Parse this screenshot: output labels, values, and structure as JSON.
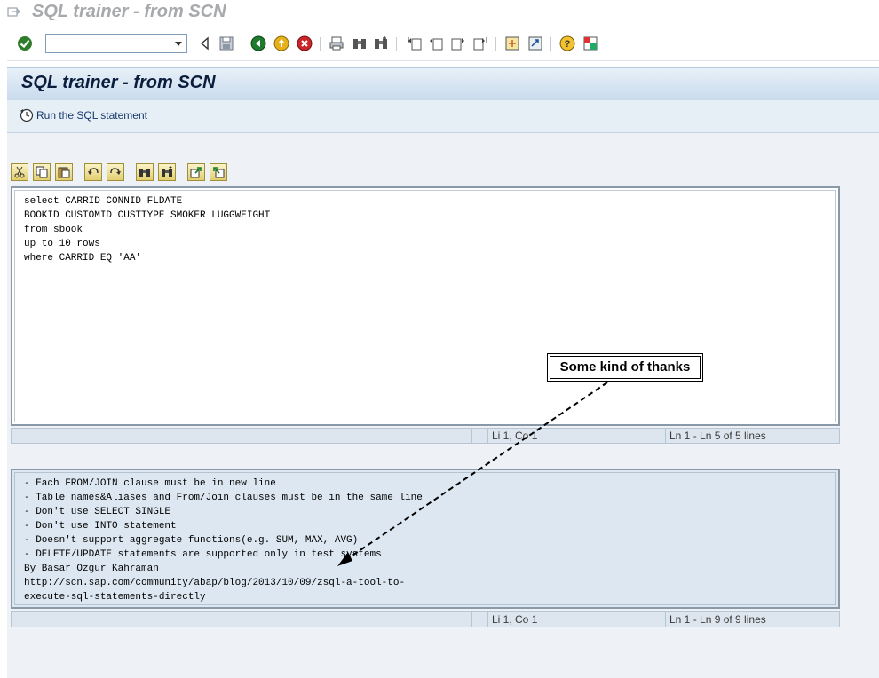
{
  "window": {
    "title": "SQL trainer - from SCN"
  },
  "toolbar": {
    "command_value": "",
    "buttons": [
      {
        "name": "enter-button",
        "icon": "checkmark-icon"
      },
      {
        "name": "save-button",
        "icon": "floppy-disk-icon"
      },
      {
        "name": "back-button",
        "icon": "green-back-arrow-icon"
      },
      {
        "name": "exit-button",
        "icon": "yellow-up-arrow-icon"
      },
      {
        "name": "cancel-button",
        "icon": "red-x-icon"
      },
      {
        "name": "print-button",
        "icon": "printer-icon"
      },
      {
        "name": "find-button",
        "icon": "binoculars-icon"
      },
      {
        "name": "find-next-button",
        "icon": "binoculars-plus-icon"
      },
      {
        "name": "first-page-button",
        "icon": "first-page-icon"
      },
      {
        "name": "previous-page-button",
        "icon": "previous-page-icon"
      },
      {
        "name": "next-page-button",
        "icon": "next-page-icon"
      },
      {
        "name": "last-page-button",
        "icon": "last-page-icon"
      },
      {
        "name": "create-session-button",
        "icon": "new-session-icon"
      },
      {
        "name": "shortcut-button",
        "icon": "shortcut-icon"
      },
      {
        "name": "help-button",
        "icon": "help-icon"
      },
      {
        "name": "layout-menu-button",
        "icon": "layout-icon"
      }
    ]
  },
  "header": {
    "title": "SQL trainer - from SCN"
  },
  "app_toolbar": {
    "run_label": "Run the SQL statement"
  },
  "editor_toolbar": {
    "icons": [
      "cut-icon",
      "copy-icon",
      "paste-icon",
      "undo-icon",
      "redo-icon",
      "find-icon",
      "find-next-icon",
      "upload-icon",
      "download-icon"
    ]
  },
  "editor": {
    "code": "select CARRID CONNID FLDATE\nBOOKID CUSTOMID CUSTTYPE SMOKER LUGGWEIGHT\nfrom sbook\nup to 10 rows\nwhere CARRID EQ 'AA'",
    "status_position": "Li 1, Co 1",
    "status_lines": "Ln 1 - Ln 5 of 5 lines"
  },
  "hints": {
    "text": "- Each FROM/JOIN clause must be in new line\n- Table names&Aliases and From/Join clauses must be in the same line\n- Don't use SELECT SINGLE\n- Don't use INTO statement\n- Doesn't support aggregate functions(e.g. SUM, MAX, AVG)\n- DELETE/UPDATE statements are supported only in test systems\nBy Basar Ozgur Kahraman\nhttp://scn.sap.com/community/abap/blog/2013/10/09/zsql-a-tool-to-\nexecute-sql-statements-directly",
    "status_position": "Li 1, Co 1",
    "status_lines": "Ln 1 - Ln 9 of 9 lines"
  },
  "callout": {
    "text": "Some kind of thanks"
  }
}
